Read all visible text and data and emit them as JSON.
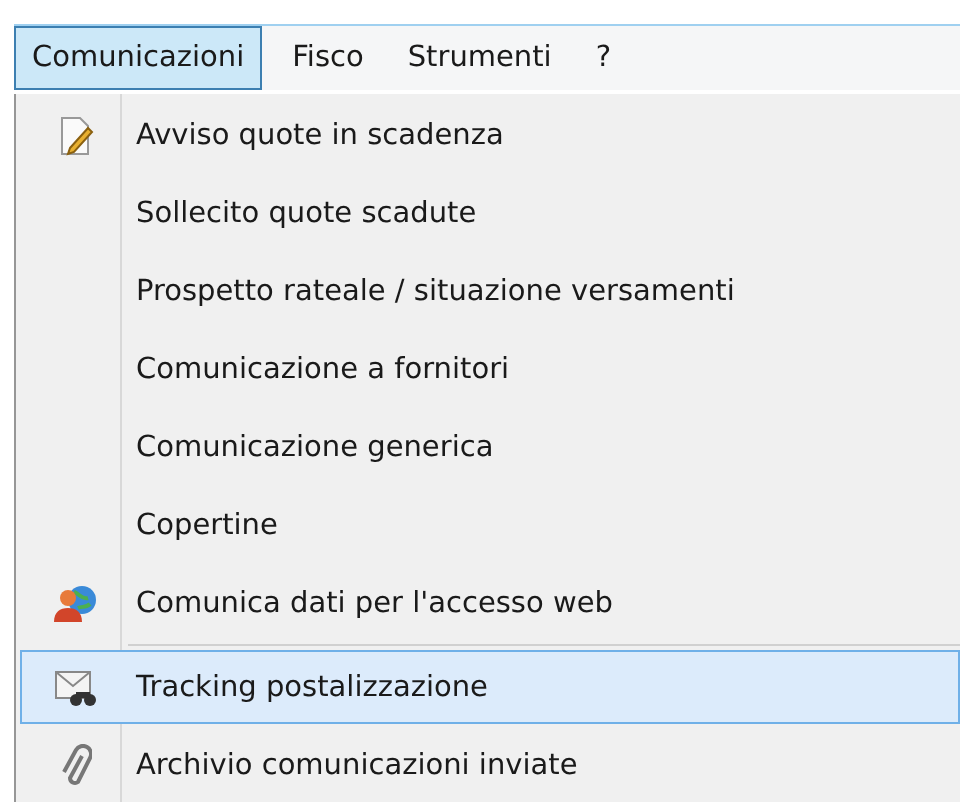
{
  "menu_bar": [
    {
      "label": "Comunicazioni",
      "selected": true
    },
    {
      "label": "Fisco",
      "selected": false
    },
    {
      "label": "Strumenti",
      "selected": false
    },
    {
      "label": "?",
      "selected": false
    }
  ],
  "menu": {
    "items": [
      {
        "kind": "note",
        "label": "Avviso quote in scadenza",
        "selected": false
      },
      {
        "kind": "plain",
        "label": "Sollecito quote scadute",
        "selected": false
      },
      {
        "kind": "plain",
        "label": "Prospetto rateale / situazione versamenti",
        "selected": false
      },
      {
        "kind": "plain",
        "label": "Comunicazione a fornitori",
        "selected": false
      },
      {
        "kind": "plain",
        "label": "Comunicazione generica",
        "selected": false
      },
      {
        "kind": "plain",
        "label": "Copertine",
        "selected": false
      },
      {
        "kind": "people",
        "label": "Comunica dati per l'accesso web",
        "selected": false
      },
      {
        "kind": "separator"
      },
      {
        "kind": "mail",
        "label": "Tracking postalizzazione",
        "selected": true
      },
      {
        "kind": "clip",
        "label": "Archivio comunicazioni inviate",
        "selected": false
      }
    ]
  }
}
